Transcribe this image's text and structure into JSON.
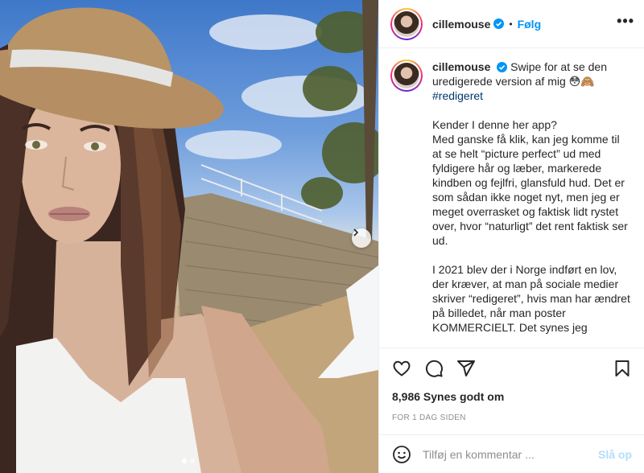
{
  "colors": {
    "accent": "#0095f6",
    "hashtag": "#00376b",
    "muted": "#8e8e8e",
    "disabled_post": "#b2dffc"
  },
  "photo": {
    "image_kind": "selfie photo of a woman wearing a straw hat in front of a stone wall and blue sky",
    "carousel": {
      "slide_count": 2,
      "active_slide": 1
    },
    "next_icon": "chevron-right-icon"
  },
  "header": {
    "username": "cillemouse",
    "verified": true,
    "separator": "•",
    "follow_label": "Følg",
    "more_label": "•••"
  },
  "caption": {
    "username": "cillemouse",
    "intro": "Swipe for at se den uredigerede version af mig 😳🙈",
    "hashtag": "#redigeret",
    "paragraph1": "Kender I denne her app?\nMed ganske få klik, kan jeg komme til at se helt “picture perfect” ud med fyldigere hår og læber, markerede kindben og fejlfri, glansfuld hud. Det er som sådan ikke noget nyt, men jeg er meget overrasket og faktisk lidt rystet over, hvor “naturligt” det rent faktisk ser ud.",
    "paragraph2": "I 2021 blev der i Norge indført en lov, der kræver, at man på sociale medier skriver “redigeret”, hvis man har ændret på billedet, når man poster KOMMERCIELT. Det synes jeg"
  },
  "actions": {
    "like_icon": "heart-icon",
    "comment_icon": "comment-icon",
    "share_icon": "paper-plane-icon",
    "save_icon": "bookmark-icon"
  },
  "likes_text": "8,986 Synes godt om",
  "timestamp": "FOR 1 DAG SIDEN",
  "comment": {
    "emoji_icon": "smiley-icon",
    "placeholder": "Tilføj en kommentar ...",
    "post_label": "Slå op"
  }
}
